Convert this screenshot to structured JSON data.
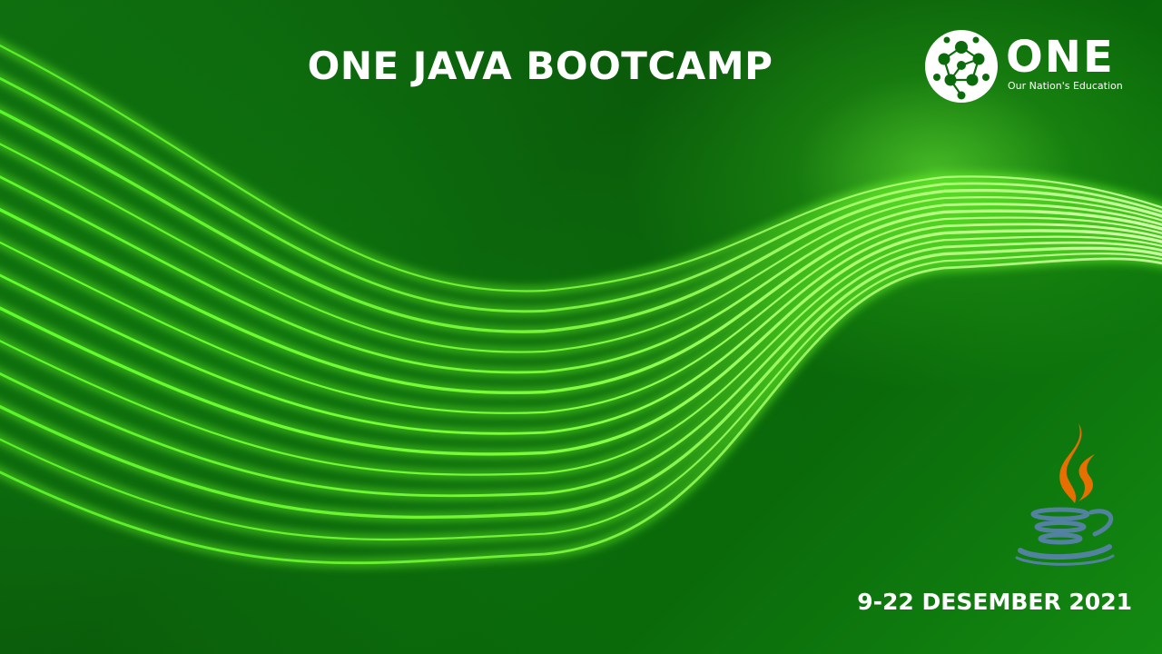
{
  "slide": {
    "title": "ONE JAVA BOOTCAMP",
    "date": "9-22 DESEMBER 2021"
  },
  "logo": {
    "wordmark": "ONE",
    "tagline": "Our Nation's Education",
    "icon": "soccer-ball-icon"
  },
  "java_logo": {
    "icon": "java-coffee-cup-icon",
    "steam_color": "#e76f00",
    "cup_color": "#5382a1"
  },
  "colors": {
    "background": "#0a5a0a",
    "wave_glow": "#7dff3a",
    "text": "#ffffff"
  }
}
